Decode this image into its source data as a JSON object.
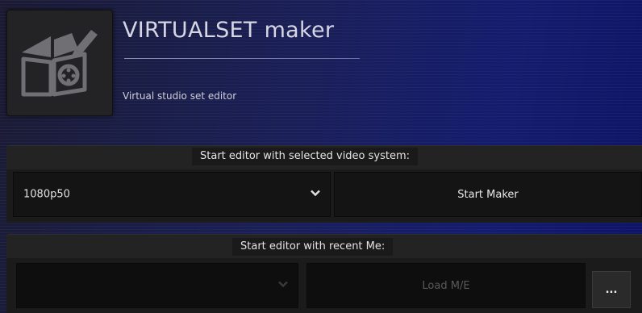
{
  "header": {
    "title": "VIRTUALSET maker",
    "subtitle": "Virtual studio set editor",
    "logo_icon": "virtual-set-book-pencil-icon"
  },
  "video_system": {
    "label": "Start editor with selected video system:",
    "selected": "1080p50",
    "start_label": "Start Maker"
  },
  "recent": {
    "label": "Start editor with recent Me:",
    "selected": "",
    "load_label": "Load M/E",
    "more_label": "..."
  },
  "colors": {
    "accent_bg": "#1a1f58",
    "panel_bg": "#1b1b1b",
    "field_bg": "#141414",
    "text": "#e6e6e6"
  }
}
